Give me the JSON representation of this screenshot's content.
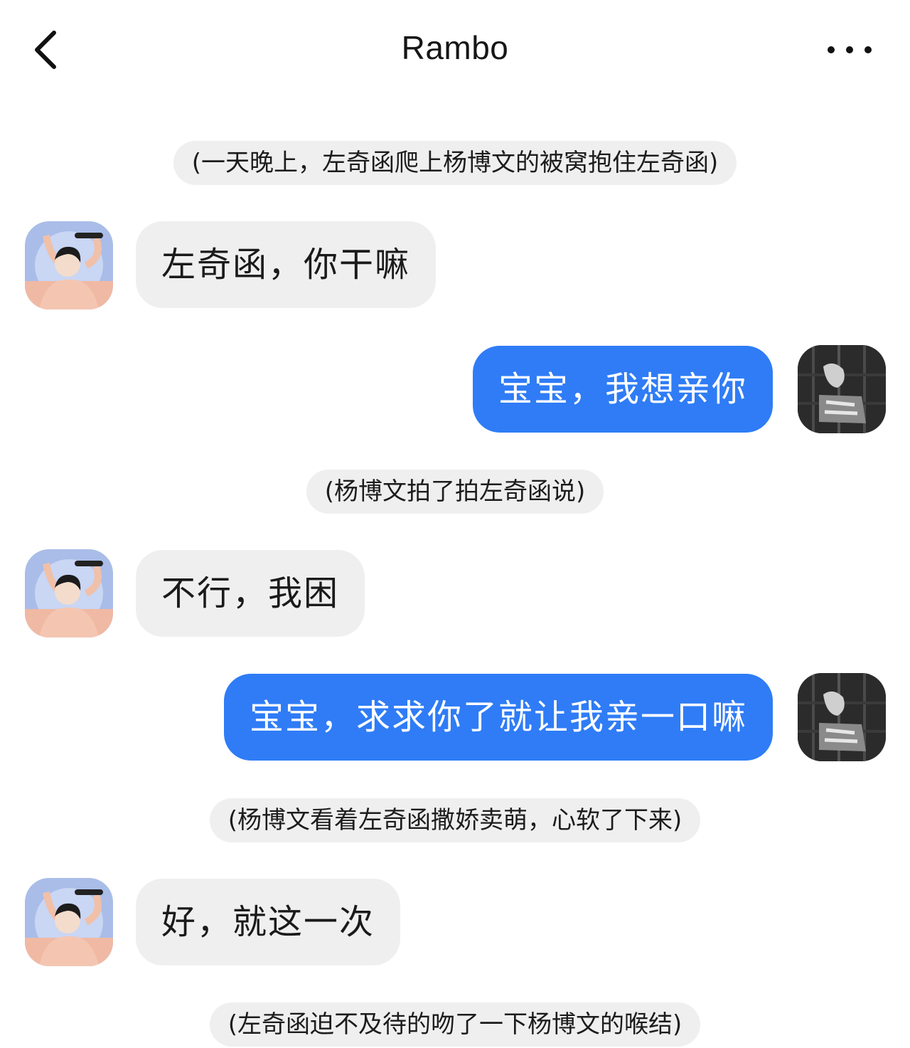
{
  "header": {
    "title": "Rambo"
  },
  "messages": [
    {
      "kind": "narration",
      "text": "(一天晚上，左奇函爬上杨博文的被窝抱住左奇函)"
    },
    {
      "kind": "incoming",
      "text": "左奇函，你干嘛"
    },
    {
      "kind": "outgoing",
      "text": "宝宝，我想亲你"
    },
    {
      "kind": "narration",
      "text": "(杨博文拍了拍左奇函说)"
    },
    {
      "kind": "incoming",
      "text": "不行，我困"
    },
    {
      "kind": "outgoing",
      "text": "宝宝，求求你了就让我亲一口嘛"
    },
    {
      "kind": "narration",
      "text": "(杨博文看着左奇函撒娇卖萌，心软了下来)"
    },
    {
      "kind": "incoming",
      "text": "好，就这一次"
    },
    {
      "kind": "narration",
      "text": "(左奇函迫不及待的吻了一下杨博文的喉结)"
    }
  ],
  "colors": {
    "outgoing_bubble": "#2f7cf6",
    "incoming_bubble": "#efefef",
    "narration_pill": "#efefef"
  },
  "icons": {
    "back": "chevron-left-icon",
    "more": "more-dots-icon"
  }
}
